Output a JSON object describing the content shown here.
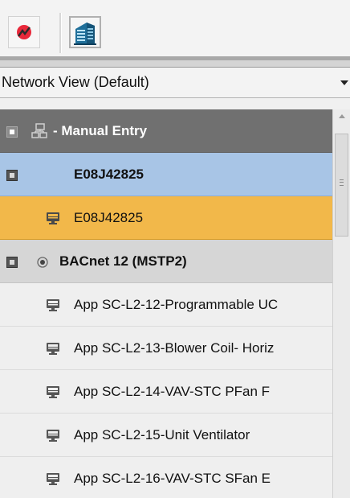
{
  "toolbar": {
    "buttons": [
      {
        "icon": "status-red-icon"
      },
      {
        "icon": "building-icon"
      }
    ]
  },
  "view_selector": {
    "value": "Network View (Default)"
  },
  "tree": {
    "manual_entry": "- Manual Entry",
    "device_group": "E08J42825",
    "device_selected": "E08J42825",
    "network": "BACnet 12 (MSTP2)",
    "apps": [
      "App SC-L2-12-Programmable UC",
      "App SC-L2-13-Blower Coil- Horiz",
      "App SC-L2-14-VAV-STC PFan F",
      "App SC-L2-15-Unit Ventilator",
      "App SC-L2-16-VAV-STC SFan E"
    ]
  },
  "colors": {
    "manual_row": "#707070",
    "device_row": "#a8c5e6",
    "selected_row": "#f2b84a",
    "network_row": "#d6d6d6"
  }
}
